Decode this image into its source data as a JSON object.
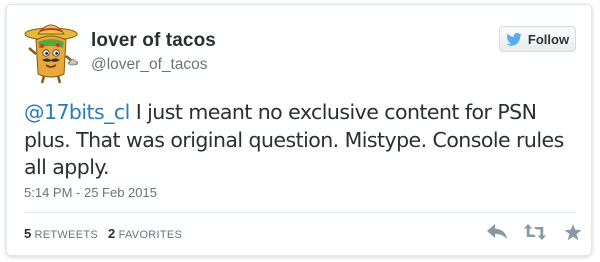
{
  "user": {
    "display_name": "lover of tacos",
    "handle": "@lover_of_tacos",
    "avatar_icon": "taco-sombrero-mascot-icon"
  },
  "follow_button": {
    "label": "Follow",
    "icon": "bird-icon"
  },
  "tweet": {
    "mention": "@17bits_cl",
    "text": " I just meant no exclusive content for PSN plus. That was original question. Mistype. Console rules all apply.",
    "timestamp": "5:14 PM - 25 Feb 2015"
  },
  "stats": {
    "retweets_count": "5",
    "retweets_label": "RETWEETS",
    "favorites_count": "2",
    "favorites_label": "FAVORITES"
  },
  "actions": [
    {
      "name": "reply",
      "icon": "reply-icon"
    },
    {
      "name": "retweet",
      "icon": "retweet-icon"
    },
    {
      "name": "favorite",
      "icon": "star-icon"
    }
  ],
  "colors": {
    "link": "#2b7bb9",
    "text": "#292f33",
    "muted": "#66757f",
    "bird": "#55acee",
    "icon": "#8899a6"
  }
}
